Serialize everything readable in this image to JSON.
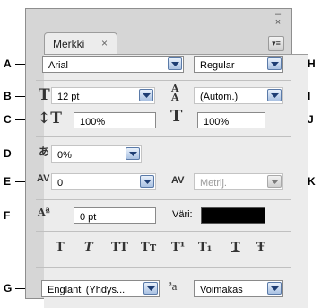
{
  "panel": {
    "tab_label": "Merkki",
    "tab_close": "×",
    "minimize": "–",
    "close": "×",
    "menu_glyph": "▾≡"
  },
  "font": {
    "family": "Arial",
    "style": "Regular"
  },
  "size": {
    "font_size": "12 pt",
    "leading": "(Autom.)"
  },
  "scale": {
    "vertical": "100%",
    "horizontal": "100%"
  },
  "tsume": {
    "value": "0%"
  },
  "kerning": {
    "value": "0",
    "tracking": "Metrij."
  },
  "baseline": {
    "shift": "0 pt",
    "color_label": "Väri:",
    "color": "#000000"
  },
  "language": {
    "value": "Englanti (Yhdys...",
    "aa_label": "ªa",
    "antialias": "Voimakas"
  },
  "type_styles": [
    "T",
    "T",
    "TT",
    "Tт",
    "T¹",
    "T₁",
    "T",
    "Ŧ"
  ],
  "callouts": {
    "A": "A",
    "B": "B",
    "C": "C",
    "D": "D",
    "E": "E",
    "F": "F",
    "G": "G",
    "H": "H",
    "I": "I",
    "J": "J",
    "K": "K"
  },
  "icons": {
    "font_size": "font-size-icon",
    "leading": "leading-icon",
    "vertical_scale": "vertical-scale-icon",
    "horizontal_scale": "horizontal-scale-icon",
    "tsume": "tsume-icon",
    "kerning": "kerning-icon",
    "tracking": "tracking-icon",
    "baseline": "baseline-shift-icon"
  }
}
